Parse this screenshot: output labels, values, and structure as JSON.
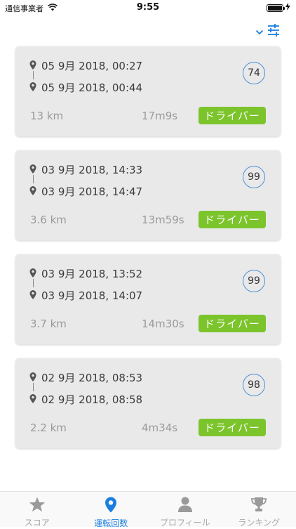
{
  "status": {
    "carrier": "通信事業者",
    "time": "9:55"
  },
  "trips": [
    {
      "start": "05 9月 2018, 00:27",
      "end": "05 9月 2018, 00:44",
      "score": "74",
      "distance": "13 km",
      "duration": "17m9s",
      "role": "ドライバー"
    },
    {
      "start": "03 9月 2018, 14:33",
      "end": "03 9月 2018, 14:47",
      "score": "99",
      "distance": "3.6 km",
      "duration": "13m59s",
      "role": "ドライバー"
    },
    {
      "start": "03 9月 2018, 13:52",
      "end": "03 9月 2018, 14:07",
      "score": "99",
      "distance": "3.7 km",
      "duration": "14m30s",
      "role": "ドライバー"
    },
    {
      "start": "02 9月 2018, 08:53",
      "end": "02 9月 2018, 08:58",
      "score": "98",
      "distance": "2.2 km",
      "duration": "4m34s",
      "role": "ドライバー"
    }
  ],
  "tabs": [
    {
      "label": "スコア",
      "icon": "star-icon",
      "active": false
    },
    {
      "label": "運転回数",
      "icon": "location-pin-icon",
      "active": true
    },
    {
      "label": "プロフィール",
      "icon": "person-icon",
      "active": false
    },
    {
      "label": "ランキング",
      "icon": "trophy-icon",
      "active": false
    }
  ],
  "colors": {
    "accent": "#1a7fe0",
    "role_badge": "#7cc42c",
    "score_ring": "#4a90d9",
    "card_bg": "#e9e9e9"
  }
}
